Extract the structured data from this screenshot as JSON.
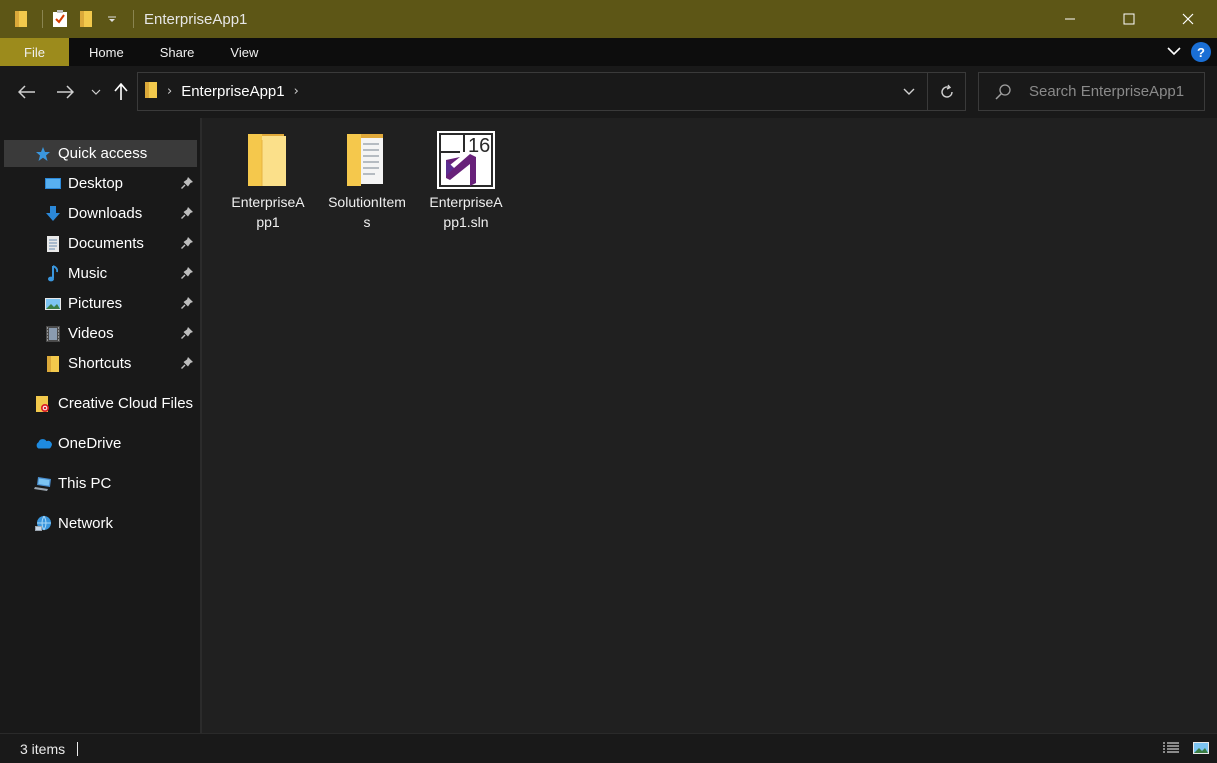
{
  "window": {
    "title": "EnterpriseApp1"
  },
  "ribbon": {
    "tabs": [
      {
        "label": "File"
      },
      {
        "label": "Home"
      },
      {
        "label": "Share"
      },
      {
        "label": "View"
      }
    ],
    "accent_color": "#9c8b1c"
  },
  "address_bar": {
    "crumbs": [
      "EnterpriseApp1"
    ]
  },
  "search": {
    "placeholder": "Search EnterpriseApp1"
  },
  "sidebar": {
    "quick_access": "Quick access",
    "pinned": [
      {
        "label": "Desktop",
        "icon": "desktop-icon"
      },
      {
        "label": "Downloads",
        "icon": "downloads-icon"
      },
      {
        "label": "Documents",
        "icon": "documents-icon"
      },
      {
        "label": "Music",
        "icon": "music-icon"
      },
      {
        "label": "Pictures",
        "icon": "pictures-icon"
      },
      {
        "label": "Videos",
        "icon": "videos-icon"
      },
      {
        "label": "Shortcuts",
        "icon": "folder-icon"
      }
    ],
    "roots": [
      {
        "label": "Creative Cloud Files",
        "icon": "creative-cloud-icon"
      },
      {
        "label": "OneDrive",
        "icon": "onedrive-icon"
      },
      {
        "label": "This PC",
        "icon": "this-pc-icon"
      },
      {
        "label": "Network",
        "icon": "network-icon"
      }
    ]
  },
  "files": [
    {
      "name": "EnterpriseApp1",
      "icon": "folder-icon"
    },
    {
      "name": "SolutionItems",
      "icon": "folder-with-docs-icon"
    },
    {
      "name": "EnterpriseApp1.sln",
      "icon": "visual-studio-solution-icon"
    }
  ],
  "status": {
    "item_count": "3 items"
  }
}
